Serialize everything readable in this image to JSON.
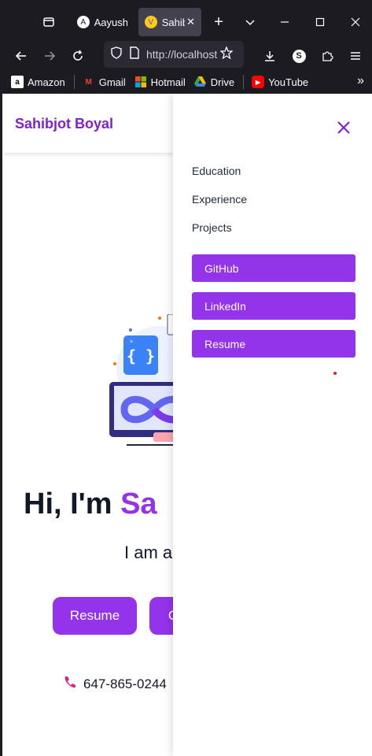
{
  "browser": {
    "tabs": [
      {
        "label": "Aayush",
        "favicon": "A"
      },
      {
        "label": "Sahibjot",
        "favicon": "V",
        "close": "✕"
      }
    ],
    "new_tab": "+",
    "url": "http://localhost",
    "bookmarks": [
      {
        "label": "Amazon",
        "icon": "a",
        "color": "#ffffff"
      },
      {
        "label": "Gmail",
        "icon": "M",
        "color": "#ea4335"
      },
      {
        "label": "Hotmail",
        "icon": "",
        "color": "#f25022"
      },
      {
        "label": "Drive",
        "icon": "",
        "color": "#34a853"
      },
      {
        "label": "YouTube",
        "icon": "▶",
        "color": "#ff0000"
      }
    ],
    "more": "»"
  },
  "site": {
    "brand": "Sahibjot Boyal",
    "hero_title_prefix": "Hi, I'm ",
    "hero_title_accent": "Sa",
    "hero_sub": "I am a",
    "hero_buttons": [
      "Resume",
      "C"
    ],
    "phone": "647-865-0244"
  },
  "drawer": {
    "links": [
      "Education",
      "Experience",
      "Projects"
    ],
    "buttons": [
      "GitHub",
      "LinkedIn",
      "Resume"
    ]
  },
  "colors": {
    "accent": "#9333ea",
    "brand": "#7e22ce"
  }
}
